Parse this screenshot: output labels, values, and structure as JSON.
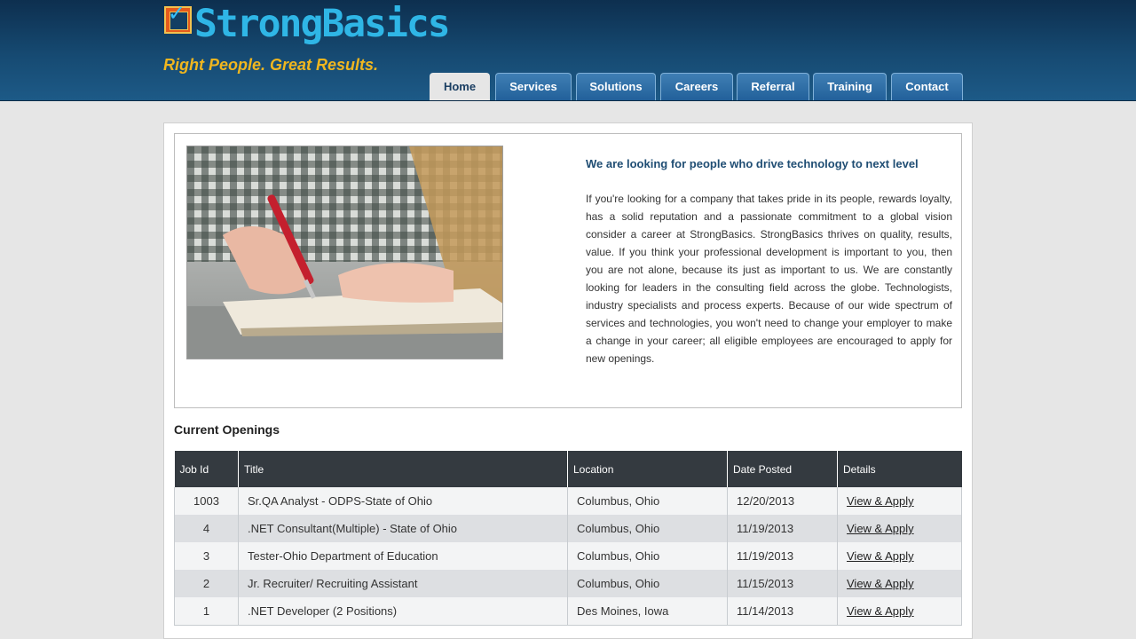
{
  "brand": {
    "name": "StrongBasics",
    "tagline": "Right People. Great Results.",
    "logo_icon": "checkmark-badge-icon"
  },
  "nav": {
    "tabs": [
      {
        "label": "Home",
        "active": true
      },
      {
        "label": "Services",
        "active": false
      },
      {
        "label": "Solutions",
        "active": false
      },
      {
        "label": "Careers",
        "active": false
      },
      {
        "label": "Referral",
        "active": false
      },
      {
        "label": "Training",
        "active": false
      },
      {
        "label": "Contact",
        "active": false
      }
    ]
  },
  "intro": {
    "heading": "We are looking for people who drive technology to next level",
    "body": "If you're looking for a company that takes pride in its people, rewards loyalty, has a solid reputation and a passionate commitment to a global vision consider a career at StrongBasics. StrongBasics thrives on quality, results, value. If you think your professional development is important to you, then you are not alone, because its just as important to us. We are constantly looking for leaders in the consulting field across the globe. Technologists, industry specialists and process experts. Because of our wide spectrum of services and technologies, you won't need to change your employer to make a change in your career; all eligible employees are encouraged to apply for new openings."
  },
  "openings": {
    "heading": "Current Openings",
    "columns": [
      "Job Id",
      "Title",
      "Location",
      "Date Posted",
      "Details"
    ],
    "rows": [
      {
        "id": "1003",
        "title": "Sr.QA Analyst - ODPS-State of Ohio",
        "location": "Columbus, Ohio",
        "date": "12/20/2013",
        "details": "View & Apply"
      },
      {
        "id": "4",
        "title": ".NET Consultant(Multiple) - State of Ohio",
        "location": "Columbus, Ohio",
        "date": "11/19/2013",
        "details": "View & Apply"
      },
      {
        "id": "3",
        "title": "Tester-Ohio Department of Education",
        "location": "Columbus, Ohio",
        "date": "11/19/2013",
        "details": "View & Apply"
      },
      {
        "id": "2",
        "title": "Jr. Recruiter/ Recruiting Assistant",
        "location": "Columbus, Ohio",
        "date": "11/15/2013",
        "details": "View & Apply"
      },
      {
        "id": "1",
        "title": ".NET Developer (2 Positions)",
        "location": "Des Moines, Iowa",
        "date": "11/14/2013",
        "details": "View & Apply"
      }
    ]
  },
  "colors": {
    "header_dark": "#0d2f4f",
    "logo_text": "#2fb6e6",
    "tagline": "#f0b61f",
    "tab": "#22609a",
    "table_header": "#343a40"
  }
}
